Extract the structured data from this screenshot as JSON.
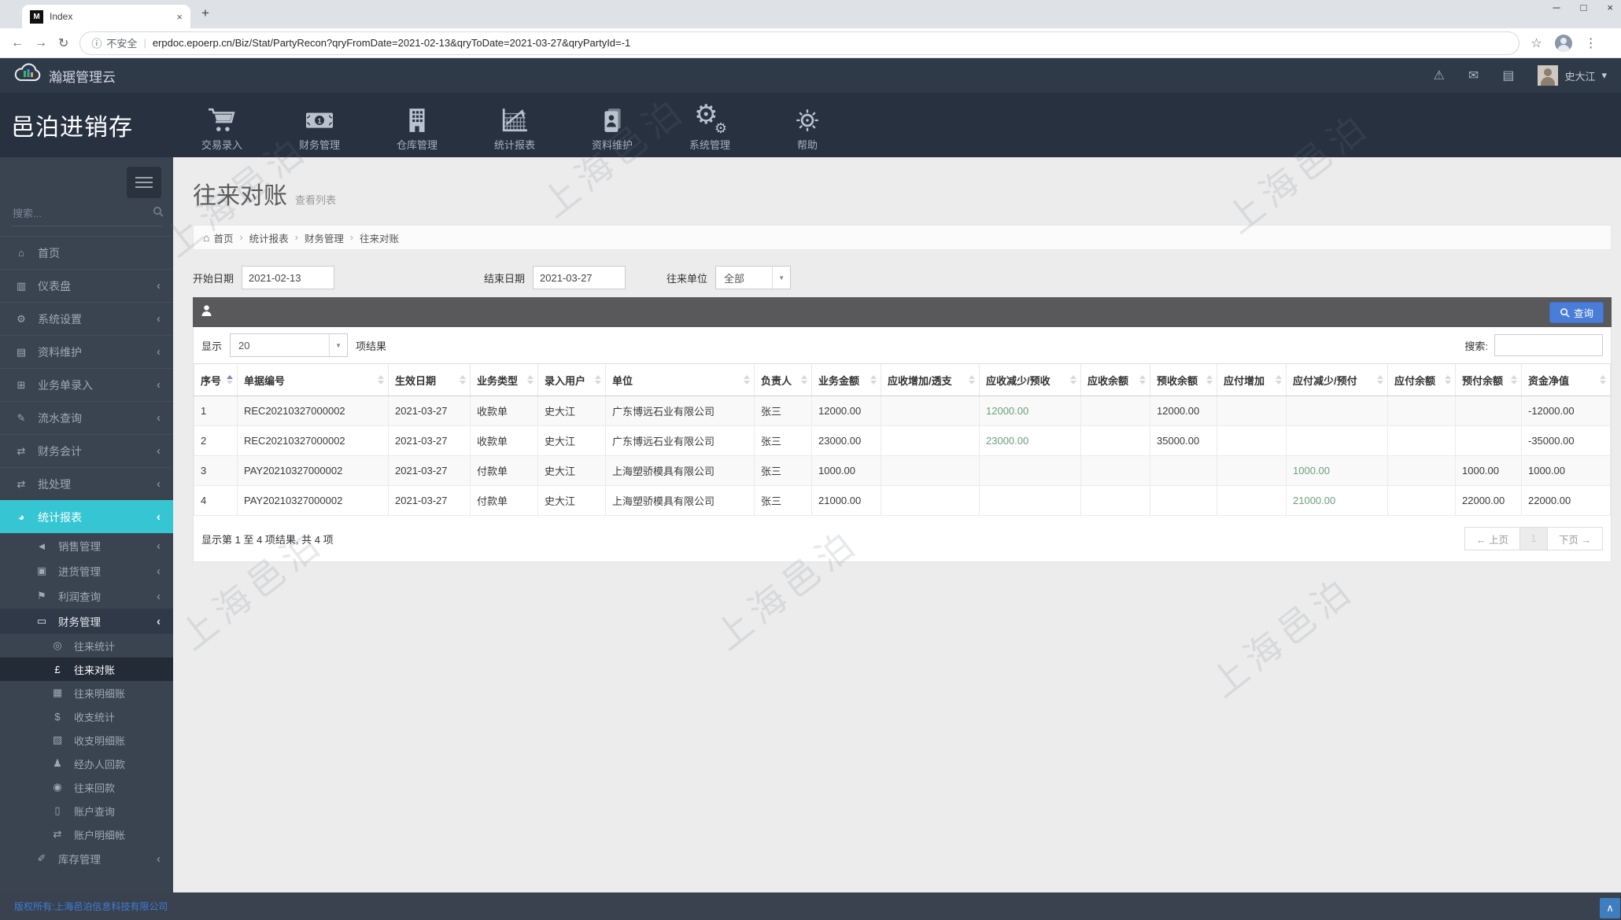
{
  "browser": {
    "favicon_letter": "M",
    "tab_title": "Index",
    "new_tab_glyph": "+",
    "tab_close_glyph": "×",
    "min_glyph": "─",
    "max_glyph": "□",
    "close_glyph": "×",
    "back_glyph": "←",
    "forward_glyph": "→",
    "reload_glyph": "↻",
    "info_glyph": "ⓘ",
    "security_text": "不安全",
    "omni_separator": "|",
    "url": "erpdoc.epoerp.cn/Biz/Stat/PartyRecon?qryFromDate=2021-02-13&qryToDate=2021-03-27&qryPartyId=-1",
    "star_glyph": "☆",
    "menu_glyph": "⋮"
  },
  "topbar": {
    "brand": "瀚琚管理云",
    "icons": [
      {
        "key": "alert",
        "glyph": "⚠"
      },
      {
        "key": "mail",
        "glyph": "✉"
      },
      {
        "key": "tasks",
        "glyph": "▤"
      }
    ],
    "user": "史大江",
    "caret_glyph": "▾"
  },
  "header": {
    "app_title": "邑泊进销存",
    "nav": [
      {
        "key": "trade-entry",
        "label": "交易录入"
      },
      {
        "key": "finance",
        "label": "财务管理"
      },
      {
        "key": "warehouse",
        "label": "仓库管理"
      },
      {
        "key": "statistics",
        "label": "统计报表"
      },
      {
        "key": "data-maintenance",
        "label": "资料维护"
      },
      {
        "key": "system",
        "label": "系统管理"
      },
      {
        "key": "help",
        "label": "帮助"
      }
    ]
  },
  "sidebar": {
    "search_placeholder": "搜索...",
    "chevron_glyph": "‹",
    "items": [
      {
        "key": "home",
        "label": "首页",
        "icon": "home-icon",
        "glyph": "⌂",
        "level": 0,
        "chevron": false
      },
      {
        "key": "dashboard",
        "label": "仪表盘",
        "icon": "chart-bar-icon",
        "glyph": "▥",
        "level": 0,
        "chevron": true
      },
      {
        "key": "system-settings",
        "label": "系统设置",
        "icon": "gears-icon",
        "glyph": "⚙",
        "level": 0,
        "chevron": true
      },
      {
        "key": "data-maintenance",
        "label": "资料维护",
        "icon": "book-icon",
        "glyph": "▤",
        "level": 0,
        "chevron": true
      },
      {
        "key": "order-entry",
        "label": "业务单录入",
        "icon": "cart-icon",
        "glyph": "⊞",
        "level": 0,
        "chevron": true
      },
      {
        "key": "transaction-query",
        "label": "流水查询",
        "icon": "pencil-icon",
        "glyph": "✎",
        "level": 0,
        "chevron": true
      },
      {
        "key": "financial-accounting",
        "label": "财务会计",
        "icon": "shuffle-icon",
        "glyph": "⇄",
        "level": 0,
        "chevron": true
      },
      {
        "key": "batch-processing",
        "label": "批处理",
        "icon": "shuffle-icon",
        "glyph": "⇄",
        "level": 0,
        "chevron": true
      },
      {
        "key": "statistics-reports",
        "label": "统计报表",
        "icon": "pie-chart-icon",
        "glyph": "◕",
        "level": 0,
        "chevron": true,
        "state": "teal"
      },
      {
        "key": "sales-management",
        "label": "销售管理",
        "icon": "megaphone-icon",
        "glyph": "◄",
        "level": 1,
        "chevron": true
      },
      {
        "key": "purchase-management",
        "label": "进货管理",
        "icon": "briefcase-icon",
        "glyph": "▣",
        "level": 1,
        "chevron": true
      },
      {
        "key": "profit-query",
        "label": "利润查询",
        "icon": "flag-icon",
        "glyph": "⚑",
        "level": 1,
        "chevron": true
      },
      {
        "key": "finance-management",
        "label": "财务管理",
        "icon": "money-icon",
        "glyph": "▭",
        "level": 1,
        "chevron": true,
        "state": "open"
      },
      {
        "key": "party-statistics",
        "label": "往来统计",
        "icon": "binoculars-icon",
        "glyph": "◎",
        "level": 2,
        "chevron": false
      },
      {
        "key": "party-reconciliation",
        "label": "往来对账",
        "icon": "pound-icon",
        "glyph": "£",
        "level": 2,
        "chevron": false,
        "state": "current"
      },
      {
        "key": "party-ledger",
        "label": "往来明细账",
        "icon": "credit-card-icon",
        "glyph": "▦",
        "level": 2,
        "chevron": false
      },
      {
        "key": "income-expense-stats",
        "label": "收支统计",
        "icon": "dollar-icon",
        "glyph": "$",
        "level": 2,
        "chevron": false
      },
      {
        "key": "income-expense-ledger",
        "label": "收支明细账",
        "icon": "ledger-icon",
        "glyph": "▧",
        "level": 2,
        "chevron": false
      },
      {
        "key": "agent-collection",
        "label": "经办人回款",
        "icon": "person-icon",
        "glyph": "♟",
        "level": 2,
        "chevron": false
      },
      {
        "key": "party-collection",
        "label": "往来回款",
        "icon": "eye-icon",
        "glyph": "◉",
        "level": 2,
        "chevron": false
      },
      {
        "key": "account-query",
        "label": "账户查询",
        "icon": "bookmark-icon",
        "glyph": "▯",
        "level": 2,
        "chevron": false
      },
      {
        "key": "account-ledger",
        "label": "账户明细帐",
        "icon": "shuffle-icon",
        "glyph": "⇄",
        "level": 2,
        "chevron": false
      },
      {
        "key": "inventory-management",
        "label": "库存管理",
        "icon": "wand-icon",
        "glyph": "✐",
        "level": 1,
        "chevron": true
      }
    ]
  },
  "page": {
    "title": "往来对账",
    "subtitle": "查看列表",
    "breadcrumb_separator": "›",
    "home_glyph": "⌂",
    "breadcrumb": [
      {
        "key": "home",
        "label": "首页"
      },
      {
        "key": "statistics-reports",
        "label": "统计报表"
      },
      {
        "key": "finance-management",
        "label": "财务管理"
      },
      {
        "key": "party-reconciliation",
        "label": "往来对账"
      }
    ]
  },
  "filters": {
    "start_label": "开始日期",
    "start_value": "2021-02-13",
    "end_label": "结束日期",
    "end_value": "2021-03-27",
    "party_label": "往来单位",
    "party_value": "全部",
    "caret_glyph": "▼"
  },
  "portlet": {
    "query_label": "查询"
  },
  "table": {
    "show_label": "显示",
    "page_size": "20",
    "results_suffix": "项结果",
    "search_label": "搜索:",
    "headers": [
      "序号",
      "单据编号",
      "生效日期",
      "业务类型",
      "录入用户",
      "单位",
      "负责人",
      "业务金额",
      "应收增加/透支",
      "应收减少/预收",
      "应收余额",
      "预收余额",
      "应付增加",
      "应付减少/预付",
      "应付余额",
      "预付余额",
      "资金净值"
    ],
    "rows": [
      [
        "1",
        "REC20210327000002",
        "2021-03-27",
        "收款单",
        "史大江",
        "广东博远石业有限公司",
        "张三",
        "12000.00",
        "",
        "12000.00",
        "",
        "12000.00",
        "",
        "",
        "",
        "",
        "-12000.00"
      ],
      [
        "2",
        "REC20210327000002",
        "2021-03-27",
        "收款单",
        "史大江",
        "广东博远石业有限公司",
        "张三",
        "23000.00",
        "",
        "23000.00",
        "",
        "35000.00",
        "",
        "",
        "",
        "",
        "-35000.00"
      ],
      [
        "3",
        "PAY20210327000002",
        "2021-03-27",
        "付款单",
        "史大江",
        "上海塑骄模具有限公司",
        "张三",
        "1000.00",
        "",
        "",
        "",
        "",
        "",
        "1000.00",
        "",
        "1000.00",
        "1000.00"
      ],
      [
        "4",
        "PAY20210327000002",
        "2021-03-27",
        "付款单",
        "史大江",
        "上海塑骄模具有限公司",
        "张三",
        "21000.00",
        "",
        "",
        "",
        "",
        "",
        "21000.00",
        "",
        "22000.00",
        "22000.00"
      ]
    ],
    "green_cells": [
      [
        0,
        9
      ],
      [
        1,
        9
      ],
      [
        2,
        13
      ],
      [
        3,
        13
      ]
    ],
    "info": "显示第 1 至 4 项结果, 共 4 项",
    "prev_label": "← 上页",
    "current_page": "1",
    "next_label": "下页 →"
  },
  "footer": {
    "copyright": "版权所有:上海邑泊信息科技有限公司",
    "totop_glyph": "∧"
  },
  "watermark": {
    "text": "上海邑泊"
  }
}
